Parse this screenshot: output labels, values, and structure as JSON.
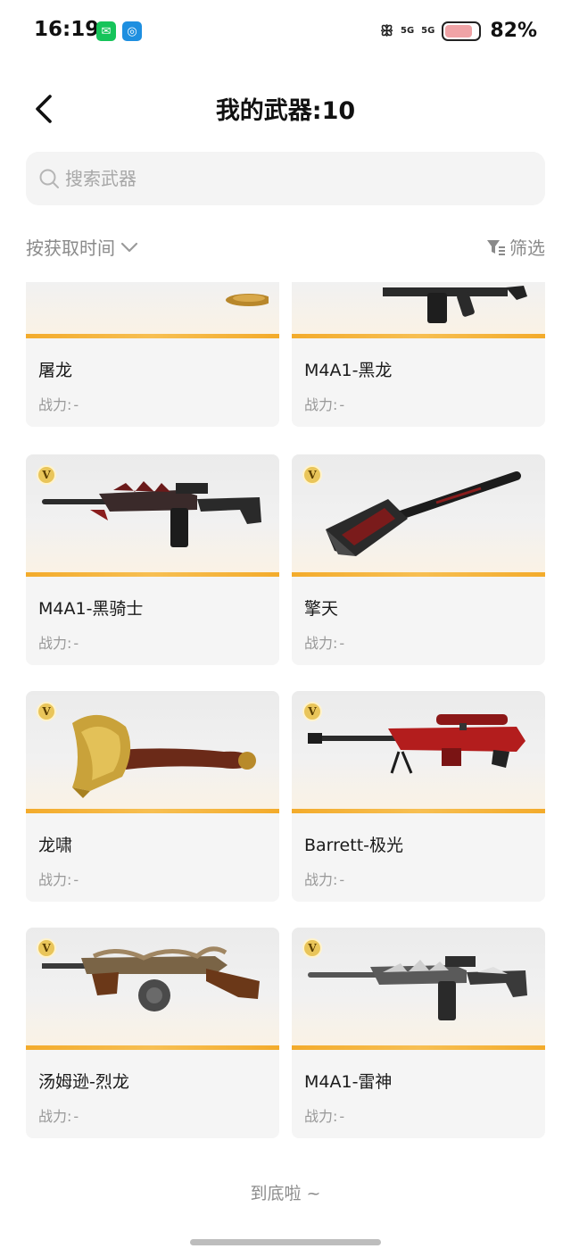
{
  "status_bar": {
    "time": "16:19",
    "apps": [
      "wechat-icon",
      "app-icon"
    ],
    "signal_1": "5G",
    "signal_2": "5G",
    "battery_percent": "82%",
    "battery_level": 0.82
  },
  "header": {
    "title": "我的武器:10"
  },
  "search": {
    "placeholder": "搜索武器",
    "value": ""
  },
  "sort": {
    "label": "按获取时间"
  },
  "filter": {
    "label": "筛选"
  },
  "weapons": [
    {
      "name": "屠龙",
      "power_label": "战力:",
      "power_value": "-",
      "badge": "",
      "partial": true
    },
    {
      "name": "M4A1-黑龙",
      "power_label": "战力:",
      "power_value": "-",
      "badge": "",
      "partial": true
    },
    {
      "name": "M4A1-黑骑士",
      "power_label": "战力:",
      "power_value": "-",
      "badge": "V"
    },
    {
      "name": "擎天",
      "power_label": "战力:",
      "power_value": "-",
      "badge": "V"
    },
    {
      "name": "龙啸",
      "power_label": "战力:",
      "power_value": "-",
      "badge": "V"
    },
    {
      "name": "Barrett-极光",
      "power_label": "战力:",
      "power_value": "-",
      "badge": "V"
    },
    {
      "name": "汤姆逊-烈龙",
      "power_label": "战力:",
      "power_value": "-",
      "badge": "V"
    },
    {
      "name": "M4A1-雷神",
      "power_label": "战力:",
      "power_value": "-",
      "badge": "V"
    }
  ],
  "end_text": "到底啦 ~",
  "colors": {
    "accent": "#f3ab2b",
    "card_bg": "#f5f5f5",
    "muted": "#999999"
  }
}
